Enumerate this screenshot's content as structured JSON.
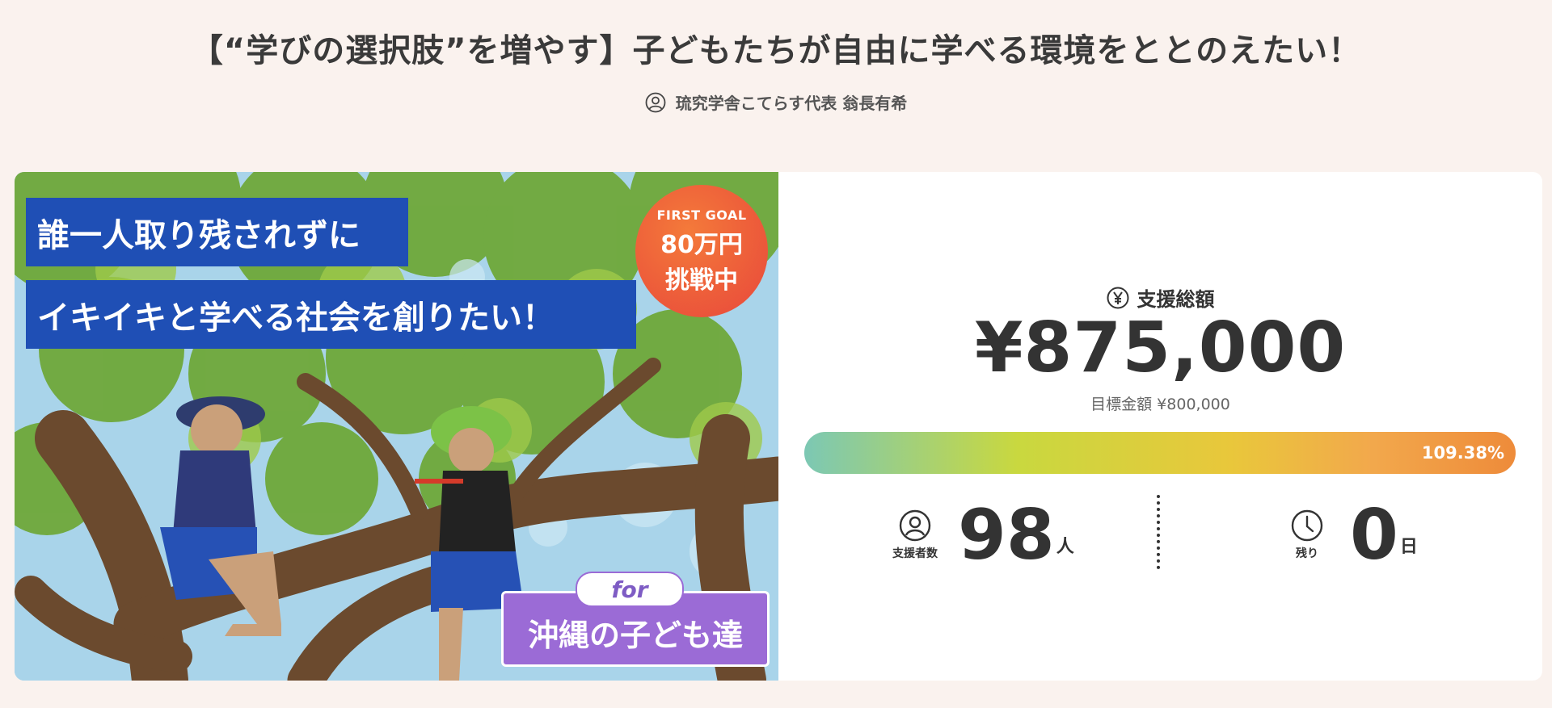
{
  "header": {
    "title": "【“学びの選択肢”を増やす】子どもたちが自由に学べる環境をととのえたい！",
    "owner": "琉究学舎こてらす代表 翁長有希",
    "owner_icon": "person-icon"
  },
  "hero": {
    "banner_line1": "誰一人取り残されずに",
    "banner_line2": "イキイキと学べる社会を創りたい！",
    "badge": {
      "line1": "FIRST GOAL",
      "line2": "80万円",
      "line3": "挑戦中"
    },
    "for_label": "for",
    "for_text": "沖縄の子ども達"
  },
  "stats": {
    "total_label": "支援総額",
    "total_icon": "yen-icon",
    "total_amount": "¥875,000",
    "target": "目標金額 ¥800,000",
    "progress_percent": "109.38%",
    "progress_fraction": 1.0,
    "supporters_label": "支援者数",
    "supporters_icon": "person-icon",
    "supporters_value": "98",
    "supporters_unit": "人",
    "remaining_label": "残り",
    "remaining_icon": "clock-icon",
    "remaining_value": "0",
    "remaining_unit": "日"
  },
  "colors": {
    "background": "#faf2ee",
    "banner_blue": "#1f4fb5",
    "badge_orange": "#ee5a3b",
    "for_purple": "#9b6bd6"
  }
}
